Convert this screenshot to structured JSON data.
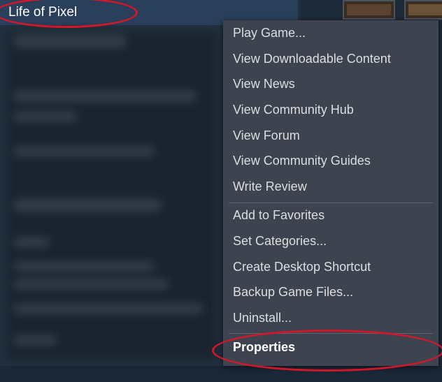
{
  "library": {
    "selected_game": "Life of Pixel"
  },
  "context_menu": {
    "group1": [
      "Play Game...",
      "View Downloadable Content",
      "View News",
      "View Community Hub",
      "View Forum",
      "View Community Guides",
      "Write Review"
    ],
    "group2": [
      "Add to Favorites",
      "Set Categories...",
      "Create Desktop Shortcut",
      "Backup Game Files...",
      "Uninstall..."
    ],
    "group3": [
      "Properties"
    ]
  },
  "colors": {
    "highlight_ring": "#d4162b",
    "menu_background": "#3d4450",
    "selected_row": "#2a3f5a"
  }
}
